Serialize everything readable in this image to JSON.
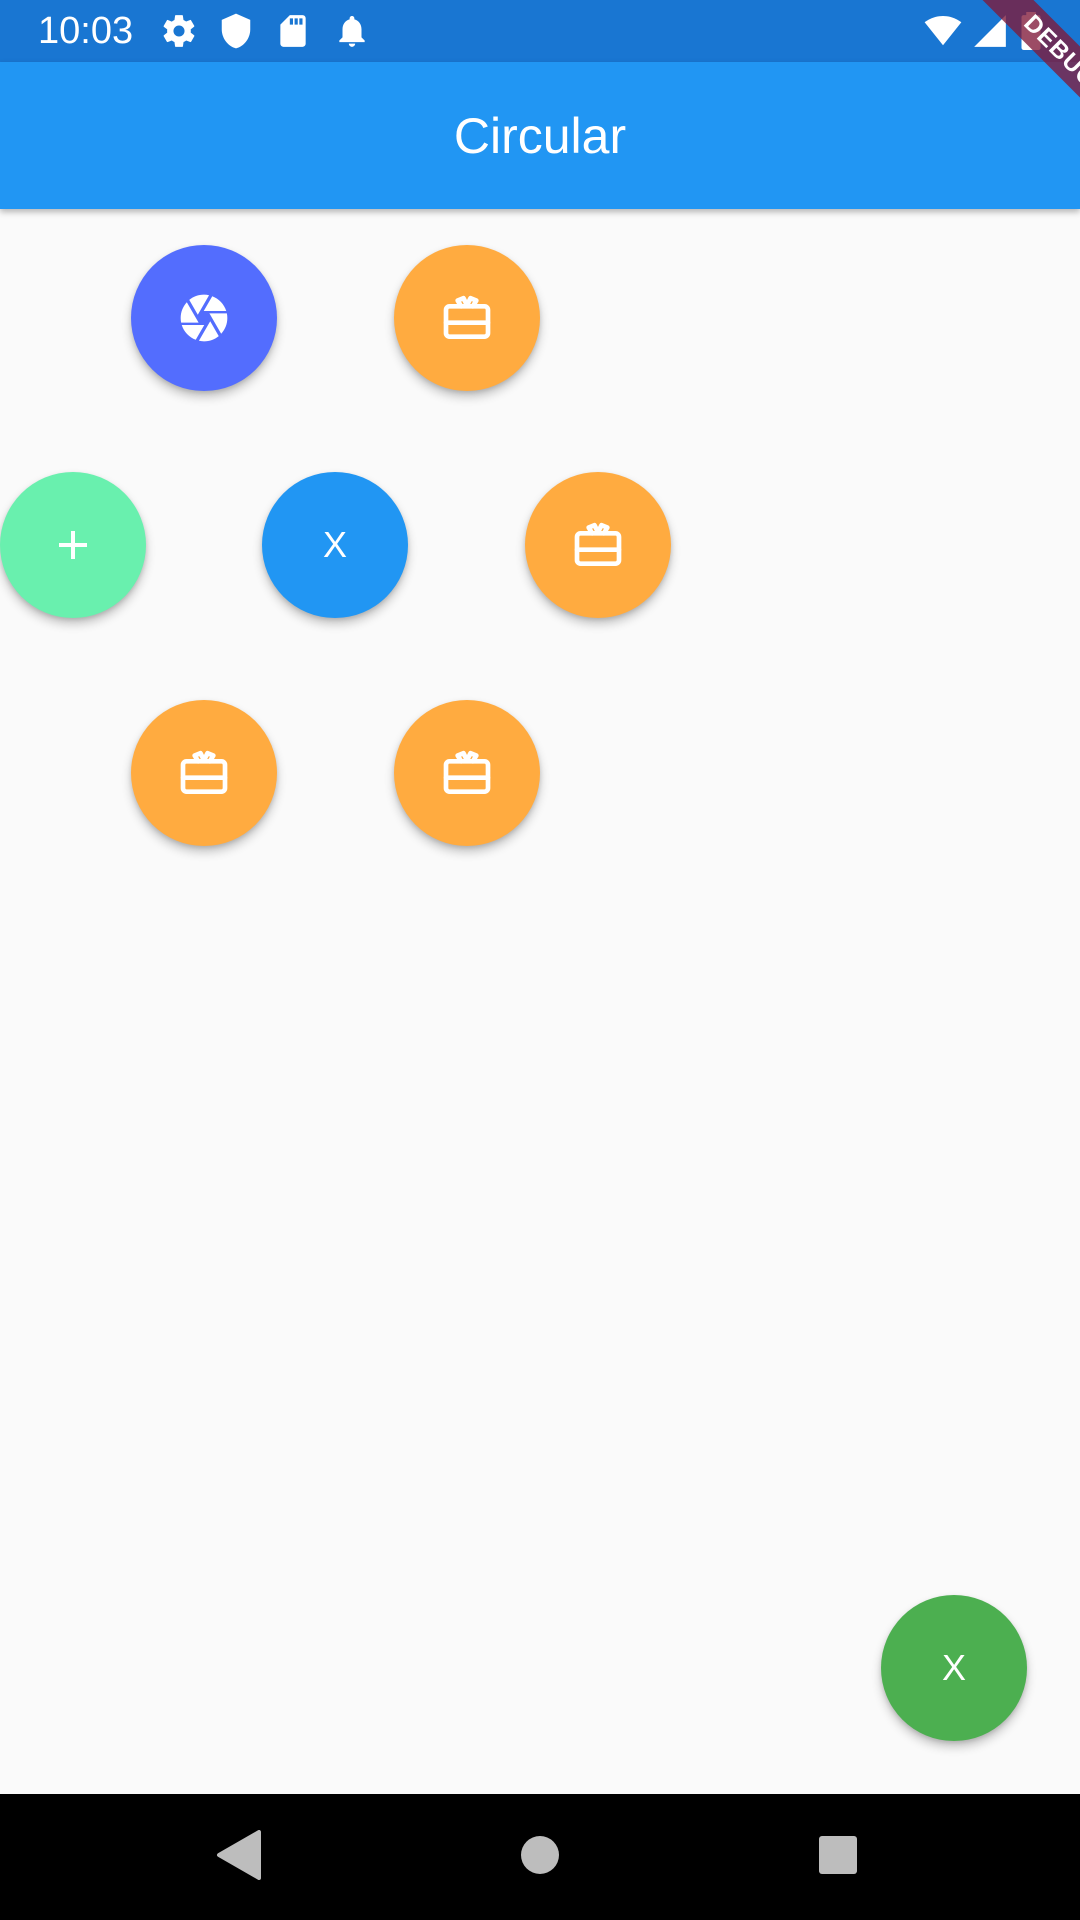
{
  "status_bar": {
    "time": "10:03",
    "left_icons": [
      "gear-icon",
      "shield-icon",
      "sd-card-icon",
      "bell-icon"
    ],
    "right_icons": [
      "wifi-icon",
      "cell-signal-icon",
      "battery-icon"
    ],
    "background": "#1976d2"
  },
  "app_bar": {
    "title": "Circular",
    "background": "#2196f3"
  },
  "debug_banner": {
    "label": "DEBUG"
  },
  "menu": {
    "center_label": "X",
    "items": [
      {
        "icon": "aperture-icon",
        "color": "#536dfe"
      },
      {
        "icon": "gift-card-icon",
        "color": "#ffab40"
      },
      {
        "icon": "add-icon",
        "color": "#69f0ae"
      },
      {
        "icon": "gift-card-icon",
        "color": "#ffab40"
      },
      {
        "icon": "gift-card-icon",
        "color": "#ffab40"
      },
      {
        "icon": "gift-card-icon",
        "color": "#ffab40"
      }
    ],
    "center_color": "#2196f3"
  },
  "fab": {
    "label": "X",
    "color": "#4caf50"
  },
  "nav_bar": {
    "buttons": [
      "back-icon",
      "home-icon",
      "recents-icon"
    ]
  }
}
